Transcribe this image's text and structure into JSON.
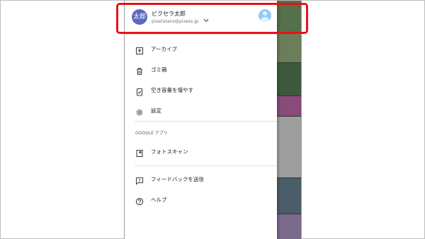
{
  "account": {
    "avatar_text": "太郎",
    "name": "ピクセラ太郎",
    "email": "pixelataro@pixela.jp"
  },
  "menu": {
    "items": [
      {
        "label": "アーカイブ",
        "icon": "archive-icon"
      },
      {
        "label": "ゴミ箱",
        "icon": "trash-icon"
      },
      {
        "label": "空き容量を増やす",
        "icon": "free-up-space-icon"
      },
      {
        "label": "設定",
        "icon": "gear-icon"
      }
    ],
    "section_title": "GOOGLE アプリ",
    "apps": [
      {
        "label": "フォトスキャン",
        "icon": "photoscan-icon"
      }
    ],
    "footer": [
      {
        "label": "フィードバックを送信",
        "icon": "feedback-icon"
      },
      {
        "label": "ヘルプ",
        "icon": "help-icon"
      }
    ]
  },
  "colors": {
    "avatar_bg": "#5c6bc0",
    "highlight": "#e8111b"
  }
}
